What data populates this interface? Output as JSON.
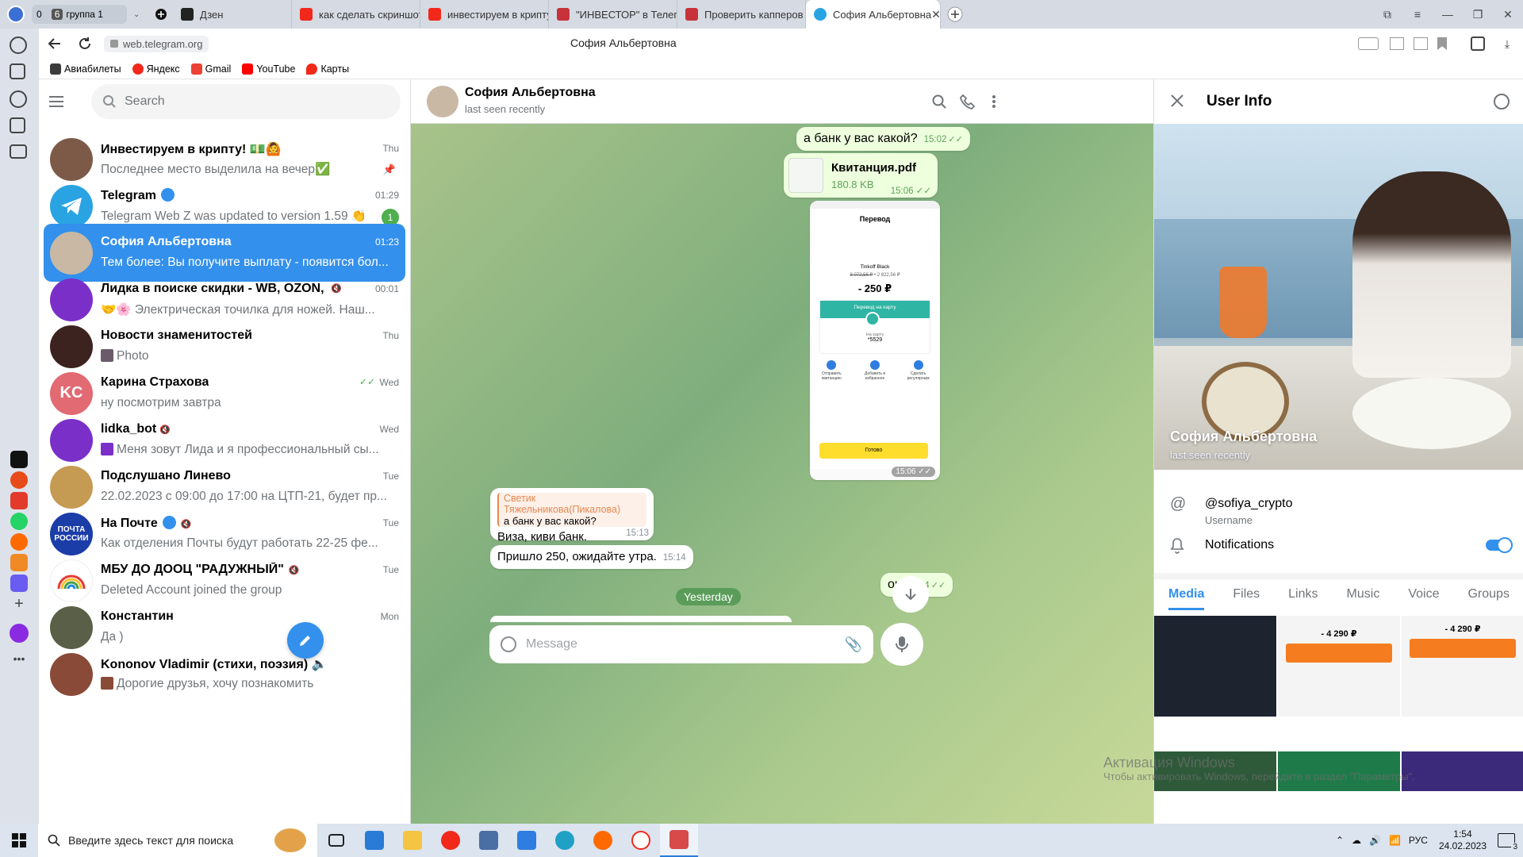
{
  "browser": {
    "tab_counter": "0",
    "group_badge": "6",
    "group_label": "группа 1",
    "tabs": [
      {
        "label": "Дзен",
        "color": "#222222"
      },
      {
        "label": "как сделать скриншот на",
        "color": "#f2281b"
      },
      {
        "label": "инвестируем в крипту сос",
        "color": "#f2281b"
      },
      {
        "label": "\"ИНВЕСТОР\" в Телеграм",
        "color": "#c8323a"
      },
      {
        "label": "Проверить капперов (Са",
        "color": "#c8323a"
      },
      {
        "label": "София Альбертовна",
        "color": "#2aa3e2",
        "active": true
      }
    ],
    "url": "web.telegram.org",
    "page_title": "София Альбертовна",
    "bookmarks": [
      {
        "label": "Авиабилеты",
        "color": "#3b3b3b"
      },
      {
        "label": "Яндекс",
        "color": "#f2281b"
      },
      {
        "label": "Gmail",
        "color": "#ea4335"
      },
      {
        "label": "YouTube",
        "color": "#ff0000"
      },
      {
        "label": "Карты",
        "color": "#f2281b"
      }
    ]
  },
  "sidebar": {
    "search_placeholder": "Search",
    "chats": [
      {
        "name": "Инвестируем в крипту! 💵🙆",
        "time": "Thu",
        "preview": "Последнее место выделила на вечер✅ ↪️Кт...",
        "avatar_color": "#7d5a48",
        "pinned": true
      },
      {
        "name": "Telegram",
        "time": "01:29",
        "preview": "Telegram Web Z was updated to version 1.59 👏",
        "avatar_color": "#2aa3e2",
        "verified": true,
        "badge": "1"
      },
      {
        "name": "София Альбертовна",
        "time": "01:23",
        "preview": "Тем более: Вы получите выплату - появится бол...",
        "avatar_color": "#c9b8a4",
        "selected": true
      },
      {
        "name": "Лидка в поиске скидки - WB, OZON, Ма...",
        "time": "00:01",
        "preview": "🤝🌸 Электрическая точилка для ножей. Наш...",
        "avatar_color": "#7b2fc9",
        "muted": true
      },
      {
        "name": "Новости знаменитостей",
        "time": "Thu",
        "preview": "Photo",
        "avatar_color": "#3c2320"
      },
      {
        "name": "Карина Страхова",
        "time": "Wed",
        "preview": "ну посмотрим завтра",
        "avatar_color": "#e16a73",
        "initials": "KC",
        "read": true
      },
      {
        "name": "lidka_bot",
        "time": "Wed",
        "preview": "Меня зовут Лида и я профессиональный сы...",
        "avatar_color": "#7b2fc9",
        "muted": true
      },
      {
        "name": "Подслушано Линево",
        "time": "Tue",
        "preview": "22.02.2023 с 09:00 до 17:00 на ЦТП-21, будет пр...",
        "avatar_color": "#c59a52"
      },
      {
        "name": "На Почте",
        "time": "Tue",
        "preview": "Как отделения Почты будут работать 22-25 фе...",
        "avatar_color": "#1b3da8",
        "initials": "ПОЧТА РОССИИ",
        "verified": true,
        "muted": true
      },
      {
        "name": "МБУ ДО ДООЦ \"РАДУЖНЫЙ\"",
        "time": "Tue",
        "preview": "Deleted Account joined the group",
        "avatar_color": "#ffffff",
        "muted": true
      },
      {
        "name": "Константин",
        "time": "Mon",
        "preview": "Да )",
        "avatar_color": "#5a6048"
      },
      {
        "name": "Kononov Vladimir (стихи, поэзия) 🔈",
        "time": "",
        "preview": "Дорогие друзья, хочу познакомить Вас",
        "avatar_color": "#8a4a38"
      }
    ]
  },
  "chat": {
    "title": "София Альбертовна",
    "status": "last seen recently",
    "messages": {
      "bank_q": {
        "text": "а банк у вас какой?",
        "time": "15:02"
      },
      "file": {
        "name": "Квитанция.pdf",
        "size": "180.8 KB",
        "time": "15:06"
      },
      "receipt": {
        "title": "Перевод",
        "card": "Tinkoff Black",
        "balance_old": "8 072,56 ₽",
        "balance_new": "2 822,56 ₽",
        "amount": "- 250 ₽",
        "transfer_label": "Перевод на карту",
        "card_num_label": "На карту",
        "card_num": "*5529",
        "action1": "Отправить квитанцию",
        "action2": "Добавить в избранное",
        "action3": "Сделать регулярным",
        "done": "Готово",
        "time": "15:06"
      },
      "reply": {
        "author": "Светик Тяжельникова(Пикалова)",
        "quoted": "а банк у вас какой?",
        "text": "Виза, киви банк.",
        "time": "15:13"
      },
      "paid": {
        "text": "Пришло 250, ожидайте утра.",
        "time": "15:14"
      },
      "ok": {
        "text": "ок",
        "time": "15:14"
      }
    },
    "date_divider": "Yesterday",
    "composer_placeholder": "Message"
  },
  "user_info": {
    "title": "User Info",
    "name": "София Альбертовна",
    "status": "last seen recently",
    "username": "@sofiya_crypto",
    "username_label": "Username",
    "notifications_label": "Notifications",
    "notifications_on": true,
    "tabs": [
      "Media",
      "Files",
      "Links",
      "Music",
      "Voice",
      "Groups"
    ],
    "active_tab": "Media",
    "media_prices": [
      "- 4 290 ₽",
      "- 4 290 ₽"
    ]
  },
  "windows": {
    "watermark_title": "Активация Windows",
    "watermark_sub": "Чтобы активировать Windows, перейдите в раздел \"Параметры\".",
    "search_placeholder": "Введите здесь текст для поиска",
    "lang": "РУС",
    "time": "1:54",
    "date": "24.02.2023",
    "notification_count": "3"
  }
}
